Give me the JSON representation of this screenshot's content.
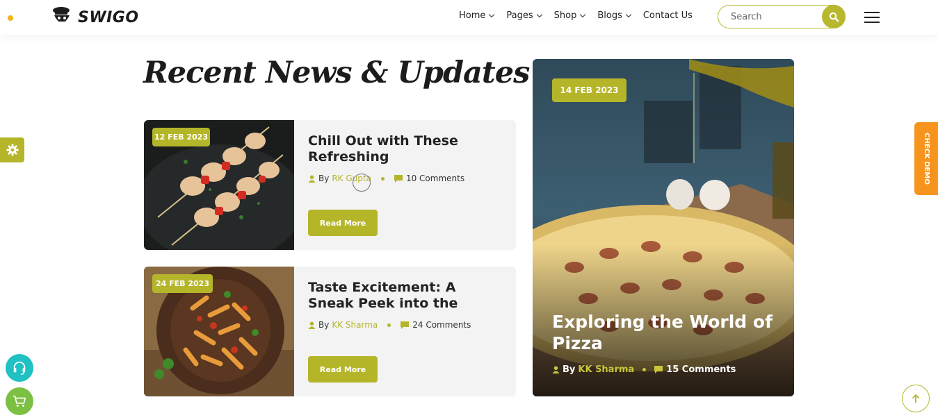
{
  "header": {
    "brand": "SWIGO",
    "nav": [
      {
        "label": "Home",
        "dropdown": true
      },
      {
        "label": "Pages",
        "dropdown": true
      },
      {
        "label": "Shop",
        "dropdown": true
      },
      {
        "label": "Blogs",
        "dropdown": true
      },
      {
        "label": "Contact Us",
        "dropdown": false
      }
    ],
    "search_placeholder": "Search"
  },
  "section": {
    "title": "Recent News & Updates"
  },
  "posts": [
    {
      "date": "12 FEB 2023",
      "title": "Chill Out with These Refreshing",
      "by": "By",
      "author": "RK Gupta",
      "comments": "10 Comments",
      "cta": "Read More",
      "image": "chicken-skewers-image"
    },
    {
      "date": "24 FEB 2023",
      "title": "Taste Excitement: A Sneak Peek into the",
      "by": "By",
      "author": "KK Sharma",
      "comments": "24 Comments",
      "cta": "Read More",
      "image": "penne-pasta-image"
    }
  ],
  "featured": {
    "date": "14 FEB 2023",
    "title": "Exploring the World of Pizza",
    "by": "By",
    "author": "KK Sharma",
    "comments": "15 Comments",
    "image": "pizza-image"
  },
  "sidebar": {
    "check_demo": "CHECK DEMO"
  },
  "colors": {
    "accent": "#b5b52a",
    "orange": "#f7941d",
    "teal": "#1fc1c3",
    "green": "#7bc043"
  }
}
